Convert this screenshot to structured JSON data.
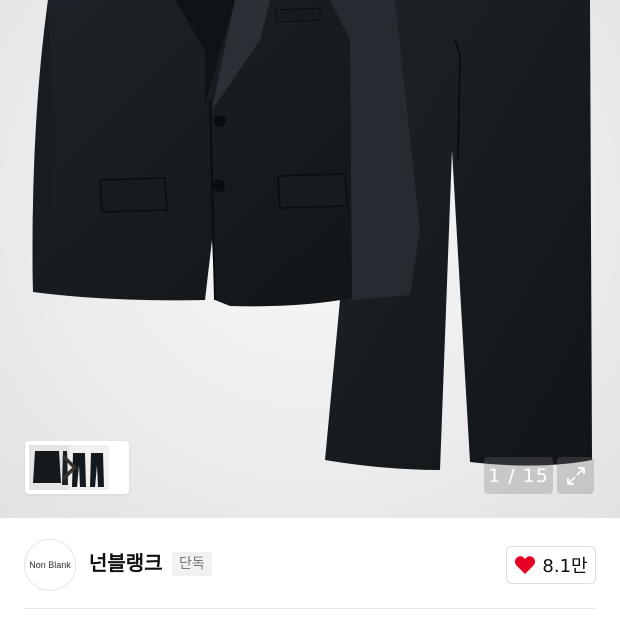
{
  "gallery": {
    "counter": "1 / 15",
    "image_alt": "Non Blank suit jacket and trousers",
    "thumbnail_arrow_icon": "chevron-right-icon",
    "expand_icon": "expand-icon"
  },
  "brand": {
    "logo_text": "Non Blank",
    "name": "넌블랭크",
    "badge": "단독",
    "likes": "8.1만",
    "like_icon": "heart-icon",
    "like_color": "#e60023"
  }
}
